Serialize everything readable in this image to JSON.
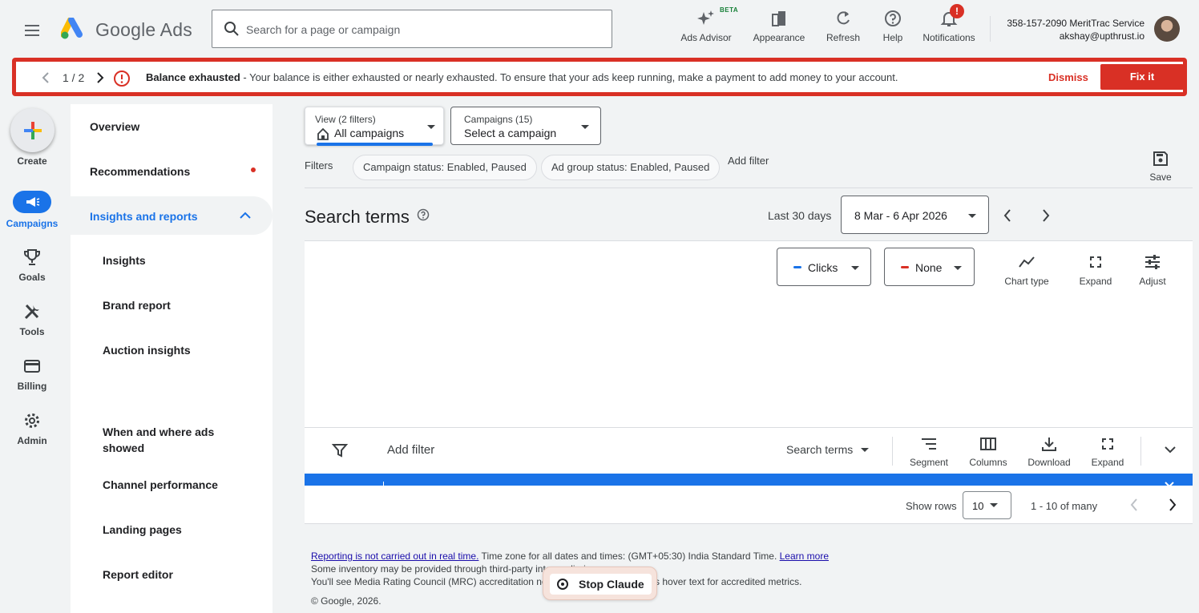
{
  "header": {
    "app_name": "Google Ads",
    "search_placeholder": "Search for a page or campaign",
    "actions": [
      {
        "label": "Ads Advisor",
        "icon": "sparkle-icon"
      },
      {
        "label": "Appearance",
        "icon": "appearance-icon"
      },
      {
        "label": "Refresh",
        "icon": "refresh-icon"
      },
      {
        "label": "Help",
        "icon": "help-icon"
      },
      {
        "label": "Notifications",
        "icon": "bell-icon"
      }
    ],
    "beta_badge": "BETA",
    "notification_badge": "!",
    "account_id": "358-157-2090 MeritTrac Service",
    "account_email": "akshay@upthrust.io"
  },
  "alert": {
    "counter": "1 / 2",
    "title": "Balance exhausted",
    "message": " - Your balance is either exhausted or nearly exhausted. To ensure that your ads keep running, make a payment to add money to your account.",
    "dismiss_label": "Dismiss",
    "fix_label": "Fix it"
  },
  "rail": {
    "create": "Create",
    "campaigns": "Campaigns",
    "goals": "Goals",
    "tools": "Tools",
    "billing": "Billing",
    "admin": "Admin"
  },
  "nav": {
    "overview": "Overview",
    "recommendations": "Recommendations",
    "insights_reports": "Insights and reports",
    "sub": [
      "Insights",
      "Brand report",
      "Auction insights",
      "When and where ads showed",
      "Channel performance",
      "Landing pages",
      "Report editor"
    ]
  },
  "main": {
    "view_small": "View (2 filters)",
    "view_value": "All campaigns",
    "campaigns_small": "Campaigns (15)",
    "campaigns_value": "Select a campaign",
    "filters_label": "Filters",
    "chips": [
      "Campaign status: Enabled, Paused",
      "Ad group status: Enabled, Paused"
    ],
    "add_filter": "Add filter",
    "save": "Save",
    "title": "Search terms",
    "date_label": "Last 30 days",
    "date_range": "8 Mar - 6 Apr 2026",
    "metric1": "Clicks",
    "metric2": "None",
    "chart_tools": [
      "Chart type",
      "Expand",
      "Adjust"
    ],
    "table_add_filter": "Add filter",
    "search_terms_dd": "Search terms",
    "table_tools": [
      "Segment",
      "Columns",
      "Download",
      "Expand"
    ],
    "show_rows": "Show rows",
    "rows_value": "10",
    "range": "1 - 10 of many"
  },
  "footer": {
    "link1": "Reporting is not carried out in real time.",
    "text1": " Time zone for all dates and times: (GMT+05:30) India Standard Time. ",
    "learn_more": "Learn more",
    "line2": "Some inventory may be provided through third-party intermediaries.",
    "line3": "You'll see Media Rating Council (MRC) accreditation noted in the column header's hover text for accredited metrics.",
    "copyright": "© Google, 2026."
  },
  "overlay": {
    "stop_label": "Stop Claude"
  },
  "colors": {
    "accent": "#1a73e8",
    "danger": "#d93025"
  }
}
